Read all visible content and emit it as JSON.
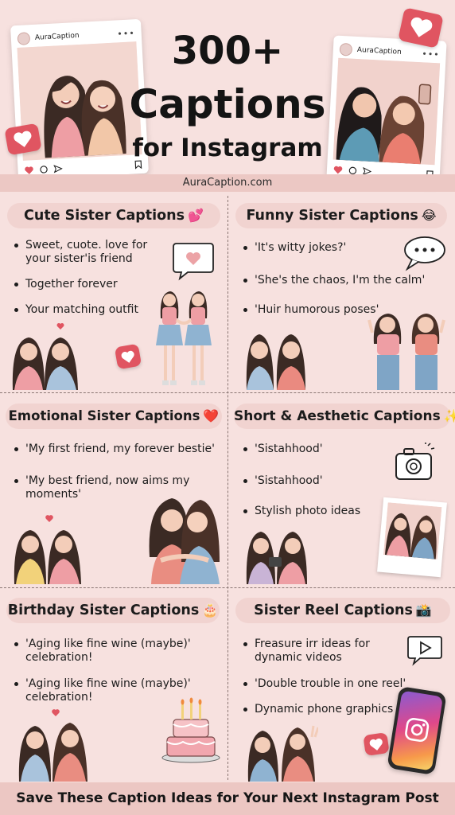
{
  "header": {
    "title_line1": "300+",
    "title_line2": "Captions",
    "title_line3": "for Instagram",
    "website": "AuraCaption.com",
    "post_left": {
      "username": "AuraCaption",
      "more_icon": "more-dots-icon"
    },
    "post_right": {
      "username": "AuraCaption",
      "more_icon": "more-dots-icon"
    }
  },
  "sections": [
    {
      "title": "Cute Sister Captions",
      "emoji": "💕",
      "items": [
        "Sweet, cuote. love for your sister'is friend",
        "Together forever",
        "Your matching outfit"
      ]
    },
    {
      "title": "Funny Sister Captions",
      "emoji": "😂",
      "items": [
        "'It's witty jokes?'",
        "'She's the chaos, I'm the calm'",
        "'Huir humorous poses'"
      ]
    },
    {
      "title": "Emotional Sister Captions",
      "emoji": "❤️",
      "items": [
        "'My first friend, my forever bestie'",
        "'My best friend, now aims my moments'"
      ]
    },
    {
      "title": "Short & Aesthetic Captions",
      "emoji": "✨",
      "items": [
        "'Sistahhood'",
        "'Sistahhood'",
        "Stylish photo ideas"
      ]
    },
    {
      "title": "Birthday Sister Captions",
      "emoji": "🎂",
      "items": [
        "'Aging like fine wine (maybe)' celebration!",
        "'Aging like fine wine (maybe)' celebration!"
      ]
    },
    {
      "title": "Sister Reel Captions",
      "emoji": "📸",
      "items": [
        "Freasure irr ideas for dynamic videos",
        "'Double trouble in one reel'",
        "Dynamic phone graphics"
      ]
    }
  ],
  "footer": {
    "text": "Save These Caption Ideas for Your Next Instagram Post"
  },
  "colors": {
    "background": "#f7e1df",
    "pill": "#f1d3d0",
    "band": "#ecc8c4",
    "heart_red": "#e05561",
    "divider": "#8a7673"
  },
  "icons": [
    "heart-icon",
    "comment-icon",
    "share-icon",
    "bookmark-icon",
    "speech-bubble-heart-icon",
    "speech-bubble-dots-icon",
    "camera-icon",
    "play-button-icon",
    "instagram-logo-icon",
    "birthday-cake-icon"
  ]
}
